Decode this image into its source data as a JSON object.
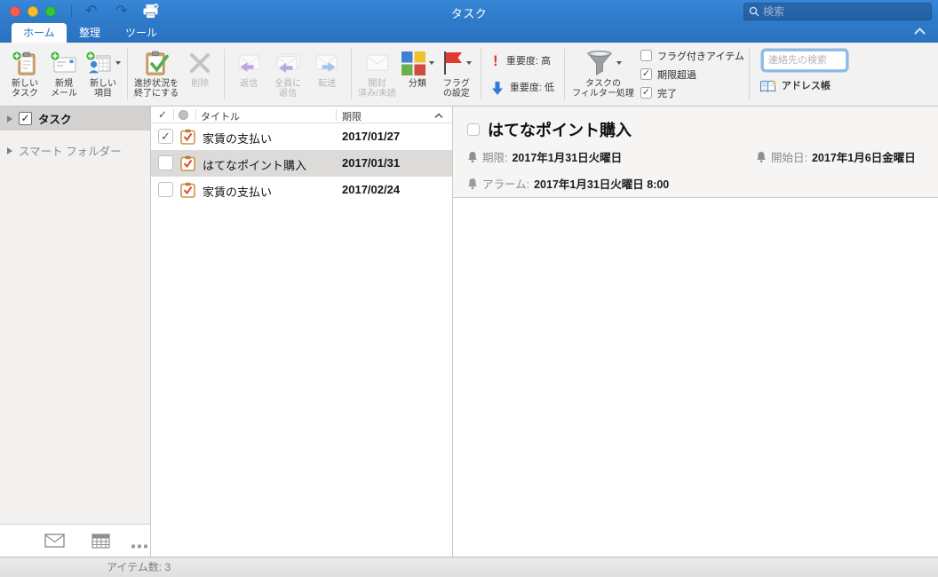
{
  "titlebar": {
    "title": "タスク",
    "search_placeholder": "検索"
  },
  "tabs": {
    "home": "ホーム",
    "organize": "整理",
    "tools": "ツール"
  },
  "ribbon": {
    "new_task_1": "新しい",
    "new_task_2": "タスク",
    "new_mail_1": "新規",
    "new_mail_2": "メール",
    "new_item_1": "新しい",
    "new_item_2": "項目",
    "progress_1": "進捗状況を",
    "progress_2": "終了にする",
    "delete": "削除",
    "reply": "返信",
    "reply_all_1": "全員に",
    "reply_all_2": "返信",
    "forward": "転送",
    "read_unread_1": "開封",
    "read_unread_2": "済み/未読",
    "categorize": "分類",
    "flag_1": "フラグ",
    "flag_2": "の設定",
    "importance_high": "重要度: 高",
    "importance_low": "重要度: 低",
    "filter_1": "タスクの",
    "filter_2": "フィルター処理",
    "cb_flagged": "フラグ付きアイテム",
    "cb_overdue": "期限超過",
    "cb_done": "完了",
    "contact_search_placeholder": "連絡先の検索",
    "address_book": "アドレス帳"
  },
  "sidebar": {
    "tasks": "タスク",
    "smart_folders": "スマート フォルダー"
  },
  "list": {
    "col_title": "タイトル",
    "col_due": "期限",
    "rows": [
      {
        "title": "家賃の支払い",
        "due": "2017/01/27",
        "checked": true
      },
      {
        "title": "はてなポイント購入",
        "due": "2017/01/31",
        "checked": false,
        "selected": true
      },
      {
        "title": "家賃の支払い",
        "due": "2017/02/24",
        "checked": false
      }
    ]
  },
  "detail": {
    "title": "はてなポイント購入",
    "due_label": "期限:",
    "due_value": "2017年1月31日火曜日",
    "start_label": "開始日:",
    "start_value": "2017年1月6日金曜日",
    "alarm_label": "アラーム:",
    "alarm_value": "2017年1月31日火曜日 8:00"
  },
  "statusbar": {
    "items_count": "アイテム数: 3"
  },
  "colors": {
    "header_blue": "#3383d3",
    "header_blue_dark": "#2a72c1",
    "selected_row": "#dcdbda",
    "sidebar_selected": "#d3d2d1",
    "badge_green": "#4db748",
    "flag_red": "#e23a2e",
    "importance_high": "#e03a2f",
    "importance_low": "#3279dd",
    "category_blue": "#3f7fd6",
    "category_yellow": "#f2c22e",
    "category_green": "#6cb04a",
    "category_red": "#cf4a41"
  }
}
